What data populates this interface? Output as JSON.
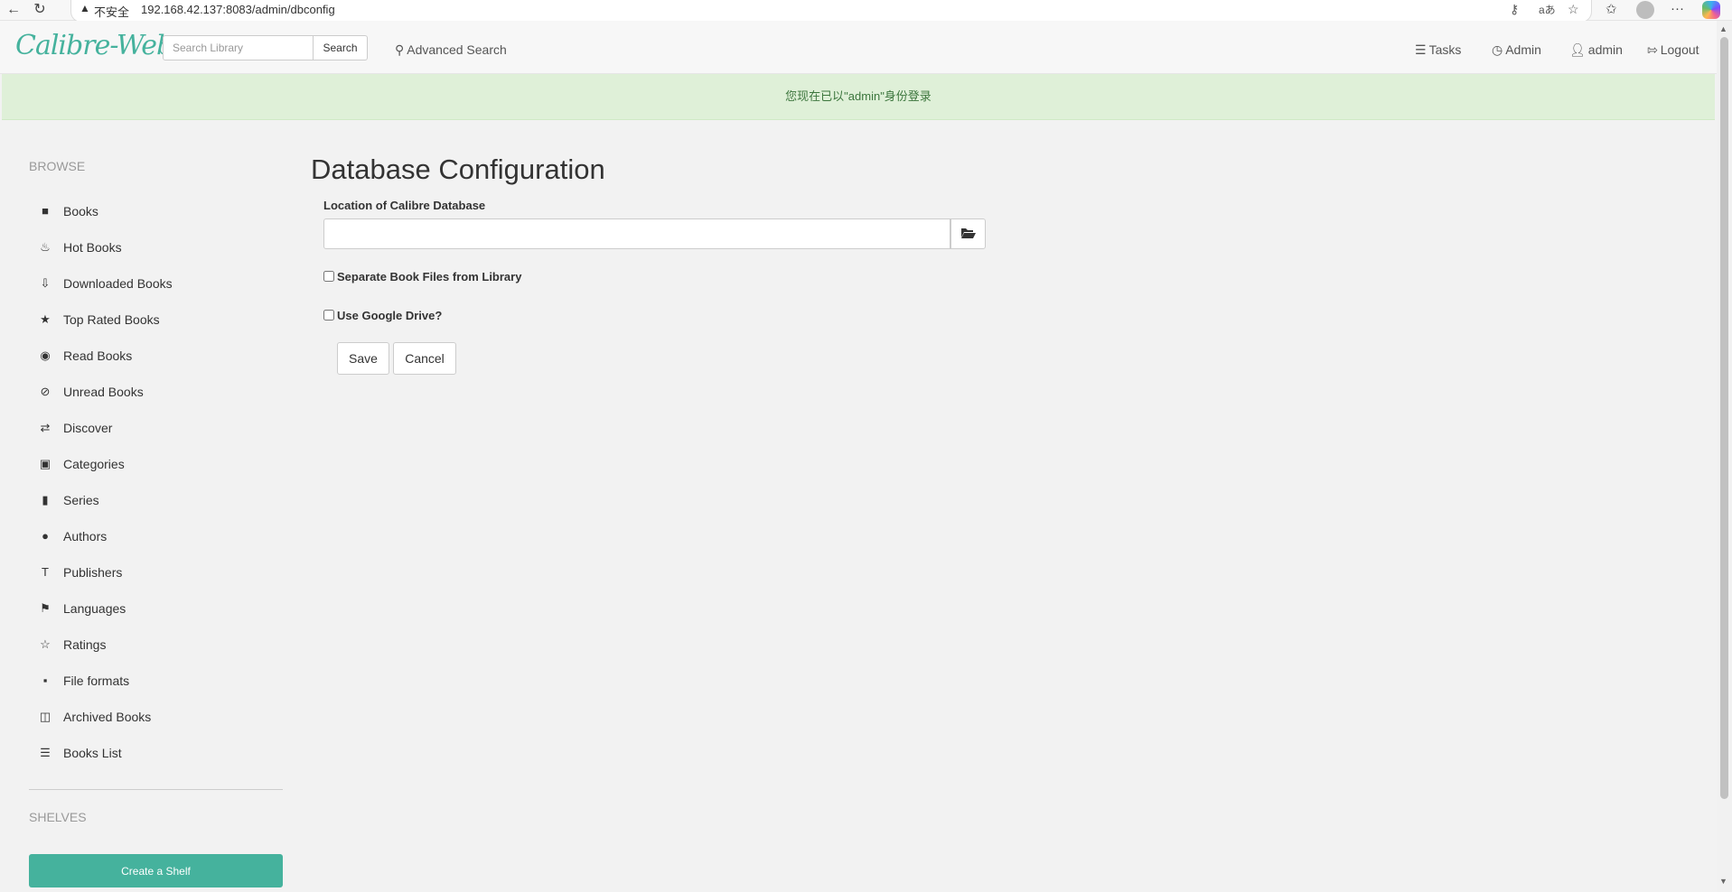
{
  "browser": {
    "back": "←",
    "reload": "↻",
    "insecure_icon": "warning-icon",
    "insecure_label": "不安全",
    "url": "192.168.42.137:8083/admin/dbconfig",
    "more": "···"
  },
  "navbar": {
    "brand": "Calibre-Web",
    "search_placeholder": "Search Library",
    "search_button": "Search",
    "advanced_search": "Advanced Search",
    "tasks": "Tasks",
    "admin": "Admin",
    "user": "admin",
    "logout": "Logout"
  },
  "alert": {
    "message": "您现在已以\"admin\"身份登录",
    "color": "#3c763d",
    "background": "#dff0d8"
  },
  "sidebar": {
    "browse_heading": "BROWSE",
    "items": [
      {
        "label": "Books",
        "icon": "book-icon"
      },
      {
        "label": "Hot Books",
        "icon": "fire-icon"
      },
      {
        "label": "Downloaded Books",
        "icon": "download-circle-icon"
      },
      {
        "label": "Top Rated Books",
        "icon": "star-icon"
      },
      {
        "label": "Read Books",
        "icon": "eye-icon"
      },
      {
        "label": "Unread Books",
        "icon": "eye-slash-icon"
      },
      {
        "label": "Discover",
        "icon": "random-icon"
      },
      {
        "label": "Categories",
        "icon": "inbox-icon"
      },
      {
        "label": "Series",
        "icon": "bookmark-icon"
      },
      {
        "label": "Authors",
        "icon": "user-icon"
      },
      {
        "label": "Publishers",
        "icon": "text-size-icon"
      },
      {
        "label": "Languages",
        "icon": "flag-icon"
      },
      {
        "label": "Ratings",
        "icon": "star-empty-icon"
      },
      {
        "label": "File formats",
        "icon": "file-icon"
      },
      {
        "label": "Archived Books",
        "icon": "trash-icon"
      },
      {
        "label": "Books List",
        "icon": "list-icon"
      }
    ],
    "shelves_heading": "SHELVES",
    "create_shelf": "Create a Shelf",
    "accent_color": "#45b29d"
  },
  "main": {
    "title": "Database Configuration",
    "db_location_label": "Location of Calibre Database",
    "db_location_value": "",
    "browse_icon": "folder-open-icon",
    "separate_files_label": "Separate Book Files from Library",
    "separate_files_checked": false,
    "google_drive_label": "Use Google Drive?",
    "google_drive_checked": false,
    "save": "Save",
    "cancel": "Cancel"
  }
}
